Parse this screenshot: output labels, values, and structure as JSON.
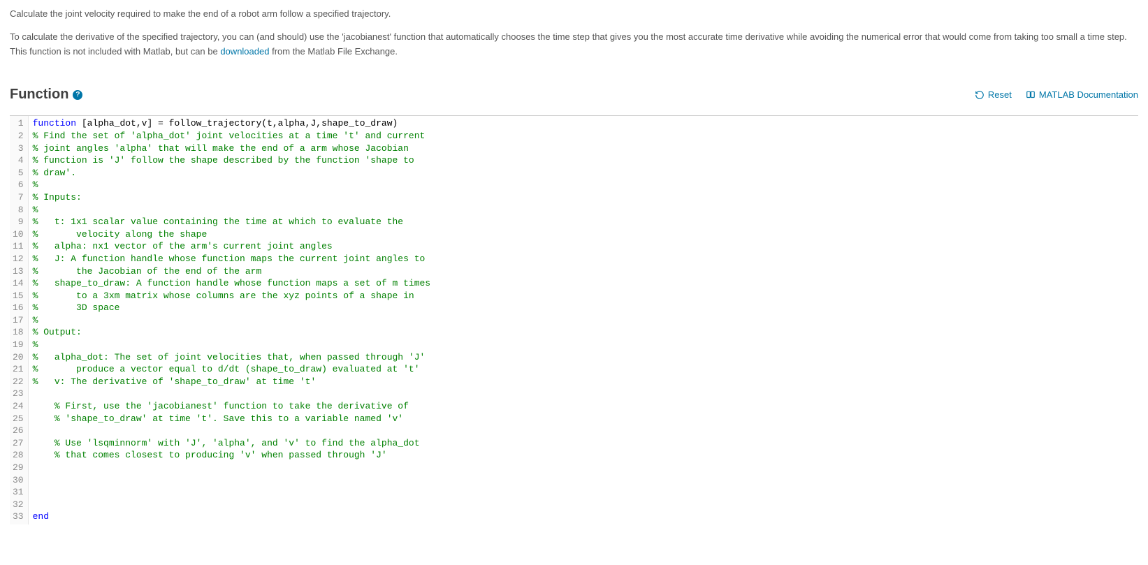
{
  "description": {
    "p1": "Calculate the joint velocity required to make the end of a robot arm follow a specified trajectory.",
    "p2a": "To calculate the derivative of the specified trajectory, you can (and should) use the 'jacobianest' function that automatically chooses the time step that gives you the most accurate time derivative while avoiding the numerical error that would come from taking too small a time step. This function is not included with Matlab, but can be ",
    "p2link": "downloaded",
    "p2b": " from the Matlab File Exchange."
  },
  "section": {
    "title": "Function",
    "reset": "Reset",
    "docs": "MATLAB Documentation"
  },
  "code": {
    "lines": [
      {
        "t": "code",
        "pre": "function",
        "mid": " [alpha_dot,v] = follow_trajectory(t,alpha,J,shape_to_draw)"
      },
      {
        "t": "comment",
        "txt": "% Find the set of 'alpha_dot' joint velocities at a time 't' and current"
      },
      {
        "t": "comment",
        "txt": "% joint angles 'alpha' that will make the end of a arm whose Jacobian"
      },
      {
        "t": "comment",
        "txt": "% function is 'J' follow the shape described by the function 'shape to"
      },
      {
        "t": "comment",
        "txt": "% draw'."
      },
      {
        "t": "comment",
        "txt": "%"
      },
      {
        "t": "comment",
        "txt": "% Inputs:"
      },
      {
        "t": "comment",
        "txt": "%"
      },
      {
        "t": "comment",
        "txt": "%   t: 1x1 scalar value containing the time at which to evaluate the"
      },
      {
        "t": "comment",
        "txt": "%       velocity along the shape"
      },
      {
        "t": "comment",
        "txt": "%   alpha: nx1 vector of the arm's current joint angles"
      },
      {
        "t": "comment",
        "txt": "%   J: A function handle whose function maps the current joint angles to"
      },
      {
        "t": "comment",
        "txt": "%       the Jacobian of the end of the arm"
      },
      {
        "t": "comment",
        "txt": "%   shape_to_draw: A function handle whose function maps a set of m times"
      },
      {
        "t": "comment",
        "txt": "%       to a 3xm matrix whose columns are the xyz points of a shape in"
      },
      {
        "t": "comment",
        "txt": "%       3D space"
      },
      {
        "t": "comment",
        "txt": "%"
      },
      {
        "t": "comment",
        "txt": "% Output:"
      },
      {
        "t": "comment",
        "txt": "%"
      },
      {
        "t": "comment",
        "txt": "%   alpha_dot: The set of joint velocities that, when passed through 'J'"
      },
      {
        "t": "comment",
        "txt": "%       produce a vector equal to d/dt (shape_to_draw) evaluated at 't'"
      },
      {
        "t": "comment",
        "txt": "%   v: The derivative of 'shape_to_draw' at time 't'"
      },
      {
        "t": "blank",
        "txt": ""
      },
      {
        "t": "comment",
        "txt": "    % First, use the 'jacobianest' function to take the derivative of"
      },
      {
        "t": "comment",
        "txt": "    % 'shape_to_draw' at time 't'. Save this to a variable named 'v'"
      },
      {
        "t": "blank",
        "txt": ""
      },
      {
        "t": "comment",
        "txt": "    % Use 'lsqminnorm' with 'J', 'alpha', and 'v' to find the alpha_dot"
      },
      {
        "t": "comment",
        "txt": "    % that comes closest to producing 'v' when passed through 'J'"
      },
      {
        "t": "blank",
        "txt": ""
      },
      {
        "t": "blank",
        "txt": ""
      },
      {
        "t": "blank",
        "txt": ""
      },
      {
        "t": "blank",
        "txt": ""
      },
      {
        "t": "keyword",
        "txt": "end"
      }
    ]
  }
}
